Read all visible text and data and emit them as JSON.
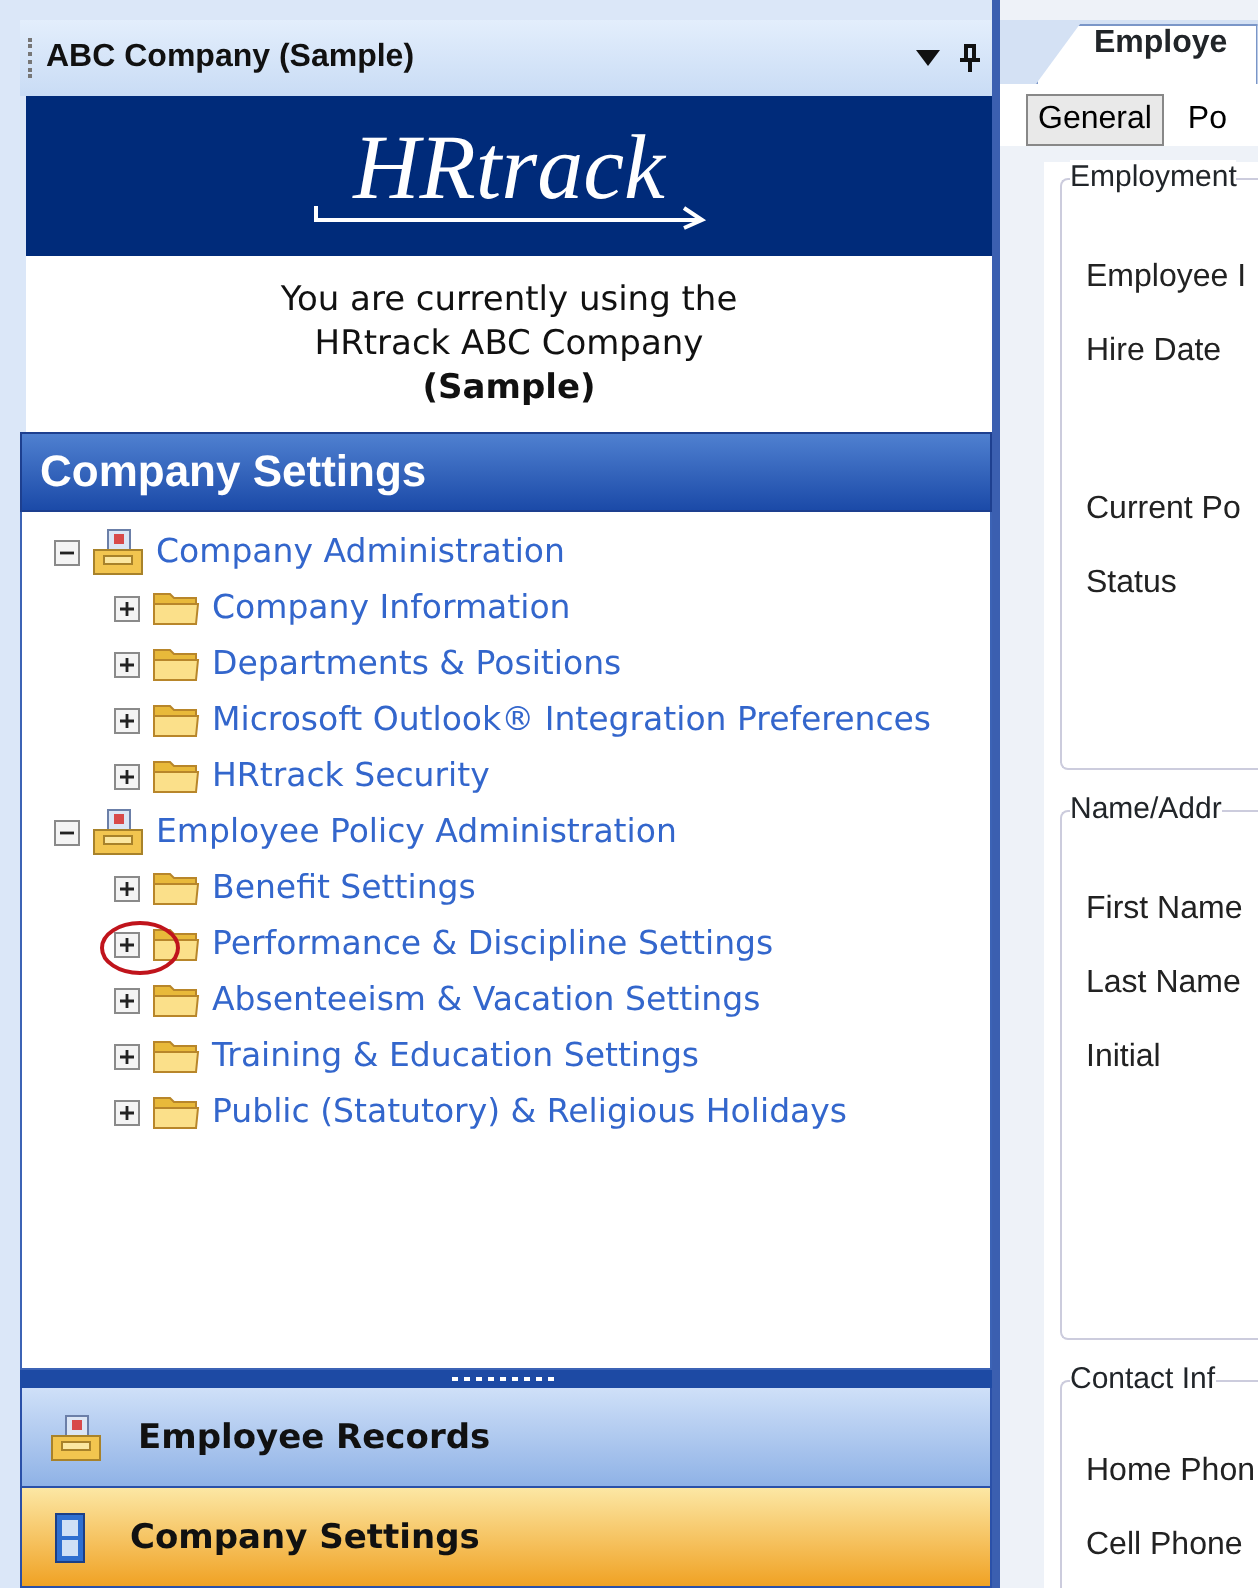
{
  "pane_header": {
    "title": "ABC Company (Sample)"
  },
  "logo": {
    "text": "HRtrack"
  },
  "welcome": {
    "lines": [
      "You are currently using the",
      "HRtrack ABC Company",
      "**(Sample)**"
    ]
  },
  "section_title": "Company Settings",
  "tree": [
    {
      "label": "Company Administration",
      "expanded": true,
      "children": [
        {
          "label": "Company Information",
          "expanded": false,
          "circled": false
        },
        {
          "label": "Departments & Positions",
          "expanded": false,
          "circled": false
        },
        {
          "label": "Microsoft Outlook® Integration Preferences",
          "expanded": false,
          "circled": false
        },
        {
          "label": "HRtrack Security",
          "expanded": false,
          "circled": false
        }
      ]
    },
    {
      "label": "Employee Policy Administration",
      "expanded": true,
      "children": [
        {
          "label": "Benefit Settings",
          "expanded": false,
          "circled": false
        },
        {
          "label": "Performance & Discipline Settings",
          "expanded": false,
          "circled": true
        },
        {
          "label": "Absenteeism & Vacation Settings",
          "expanded": false,
          "circled": false
        },
        {
          "label": "Training & Education Settings",
          "expanded": false,
          "circled": false
        },
        {
          "label": "Public (Statutory) & Religious Holidays",
          "expanded": false,
          "circled": false
        }
      ]
    }
  ],
  "nav_buttons": [
    {
      "label": "Employee Records",
      "kind": "records",
      "selected": false
    },
    {
      "label": "Company Settings",
      "kind": "settings",
      "selected": true
    }
  ],
  "document_tab": {
    "label": "Employe",
    "selected": true
  },
  "sub_tabs": [
    {
      "label": "General",
      "selected": true
    },
    {
      "label": "Po",
      "selected": false
    }
  ],
  "groups": [
    {
      "title": "Employment",
      "fields": [
        "Employee I",
        "Hire Date",
        "Current Po",
        "Status"
      ]
    },
    {
      "title": "Name/Addr",
      "fields": [
        "First Name",
        "Last Name",
        "Initial"
      ]
    },
    {
      "title": "Contact Inf",
      "fields": [
        "Home Phon",
        "Cell Phone"
      ]
    }
  ]
}
